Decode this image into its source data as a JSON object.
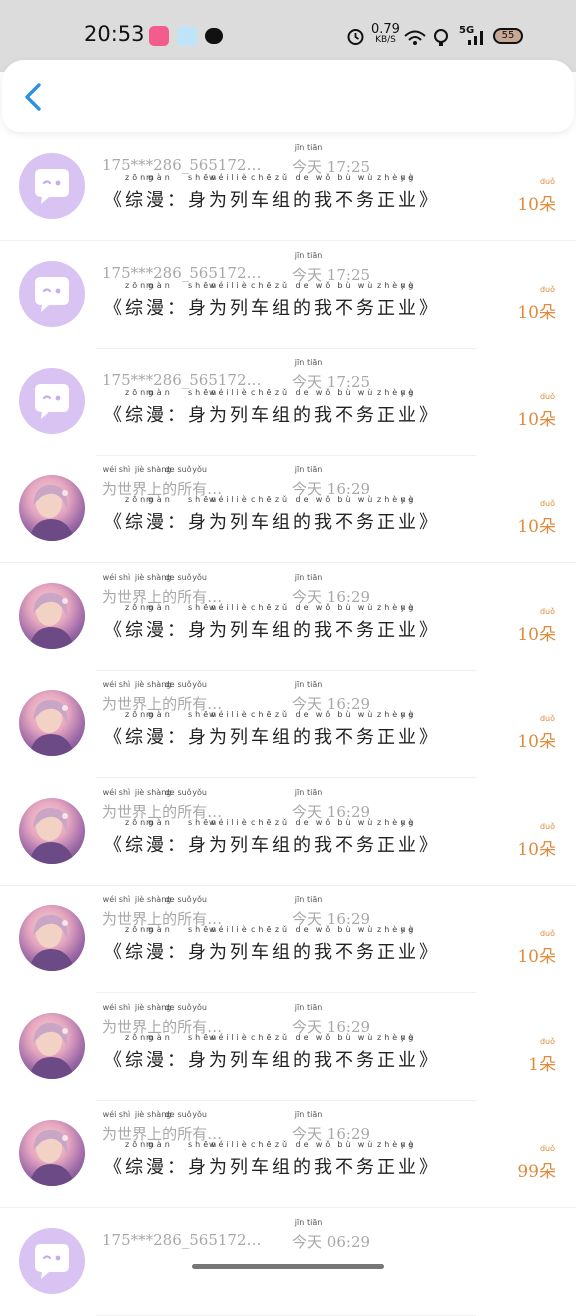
{
  "status_bar": {
    "time": "20:53",
    "speed_value": "0.79",
    "speed_unit": "KB/S",
    "network": "5G",
    "battery": "55"
  },
  "rows": [
    {
      "avatar": "robot",
      "name": "175***286_565172…",
      "time_word": "今天",
      "time": "17:25",
      "title": "《综漫：身为列车组的我不务正业》",
      "count": "10"
    },
    {
      "avatar": "robot",
      "name": "175***286_565172…",
      "time_word": "今天",
      "time": "17:25",
      "title": "《综漫：身为列车组的我不务正业》",
      "count": "10"
    },
    {
      "avatar": "robot",
      "name": "175***286_565172…",
      "time_word": "今天",
      "time": "17:25",
      "title": "《综漫：身为列车组的我不务正业》",
      "count": "10"
    },
    {
      "avatar": "girl",
      "name": "为世界上的所有…",
      "time_word": "今天",
      "time": "16:29",
      "title": "《综漫：身为列车组的我不务正业》",
      "count": "10"
    },
    {
      "avatar": "girl",
      "name": "为世界上的所有…",
      "time_word": "今天",
      "time": "16:29",
      "title": "《综漫：身为列车组的我不务正业》",
      "count": "10"
    },
    {
      "avatar": "girl",
      "name": "为世界上的所有…",
      "time_word": "今天",
      "time": "16:29",
      "title": "《综漫：身为列车组的我不务正业》",
      "count": "10"
    },
    {
      "avatar": "girl",
      "name": "为世界上的所有…",
      "time_word": "今天",
      "time": "16:29",
      "title": "《综漫：身为列车组的我不务正业》",
      "count": "10"
    },
    {
      "avatar": "girl",
      "name": "为世界上的所有…",
      "time_word": "今天",
      "time": "16:29",
      "title": "《综漫：身为列车组的我不务正业》",
      "count": "10"
    },
    {
      "avatar": "girl",
      "name": "为世界上的所有…",
      "time_word": "今天",
      "time": "16:29",
      "title": "《综漫：身为列车组的我不务正业》",
      "count": "1"
    },
    {
      "avatar": "girl",
      "name": "为世界上的所有…",
      "time_word": "今天",
      "time": "16:29",
      "title": "《综漫：身为列车组的我不务正业》",
      "count": "99"
    },
    {
      "avatar": "robot",
      "name": "175***286_565172…",
      "time_word": "今天",
      "time": "06:29",
      "title": "",
      "count": ""
    }
  ],
  "pinyin": {
    "今": "jīn",
    "天": "tiān",
    "综": "zōng",
    "漫": "màn",
    "身": "shēn",
    "为": "wéi",
    "列": "liè",
    "车": "chē",
    "组": "zǔ",
    "的": "de",
    "我": "wǒ",
    "不": "bù",
    "务": "wù",
    "正": "zhèng",
    "业": "yè",
    "世": "shì",
    "界": "jiè",
    "上": "shàng",
    "所": "suǒ",
    "有": "yǒu",
    "朵": "duǒ"
  },
  "unit": "朵",
  "colors": {
    "accent": "#2f8fe0",
    "count": "#e08a3c",
    "avatar_robot": "#d8c3f2"
  },
  "icons": {
    "back": "chevron-left-icon"
  }
}
